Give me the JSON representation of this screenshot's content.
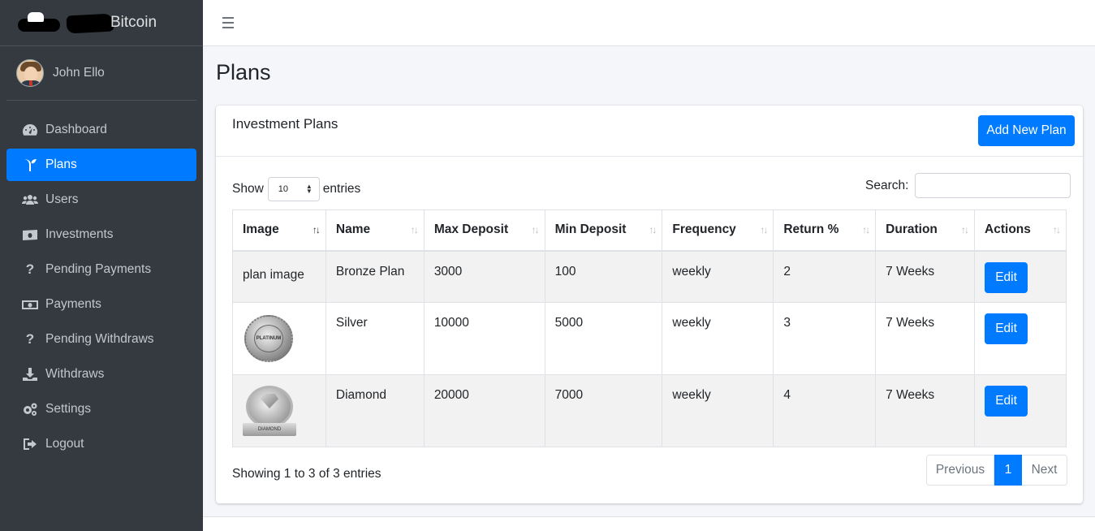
{
  "brand": {
    "name": "Bitcoin"
  },
  "user": {
    "name": "John Ello"
  },
  "sidebar": {
    "items": [
      {
        "label": "Dashboard",
        "icon": "tachometer-icon"
      },
      {
        "label": "Plans",
        "icon": "seedling-icon",
        "active": true
      },
      {
        "label": "Users",
        "icon": "users-icon"
      },
      {
        "label": "Investments",
        "icon": "money-bill-icon"
      },
      {
        "label": "Pending Payments",
        "icon": "question-icon"
      },
      {
        "label": "Payments",
        "icon": "money-bill-alt-icon"
      },
      {
        "label": "Pending Withdraws",
        "icon": "question-icon"
      },
      {
        "label": "Withdraws",
        "icon": "download-icon"
      },
      {
        "label": "Settings",
        "icon": "cogs-icon"
      },
      {
        "label": "Logout",
        "icon": "sign-out-icon"
      }
    ]
  },
  "page": {
    "title": "Plans"
  },
  "card": {
    "title": "Investment Plans",
    "add_button": "Add New Plan",
    "show_label": "Show",
    "entries_label": "entries",
    "page_length": "10",
    "search_label": "Search:",
    "search_value": ""
  },
  "table": {
    "columns": [
      "Image",
      "Name",
      "Max Deposit",
      "Min Deposit",
      "Frequency",
      "Return %",
      "Duration",
      "Actions"
    ],
    "rows": [
      {
        "image": "plan image",
        "name": "Bronze Plan",
        "max": "3000",
        "min": "100",
        "frequency": "weekly",
        "return": "2",
        "duration": "7 Weeks",
        "action": "Edit"
      },
      {
        "image": "",
        "badge_text": "PLATINUM",
        "name": "Silver",
        "max": "10000",
        "min": "5000",
        "frequency": "weekly",
        "return": "3",
        "duration": "7 Weeks",
        "action": "Edit"
      },
      {
        "image": "",
        "badge_text": "DIAMOND",
        "name": "Diamond",
        "max": "20000",
        "min": "7000",
        "frequency": "weekly",
        "return": "4",
        "duration": "7 Weeks",
        "action": "Edit"
      }
    ]
  },
  "footer": {
    "info": "Showing 1 to 3 of 3 entries",
    "previous": "Previous",
    "page": "1",
    "next": "Next"
  },
  "colors": {
    "primary": "#007bff",
    "sidebar": "#343a40"
  }
}
